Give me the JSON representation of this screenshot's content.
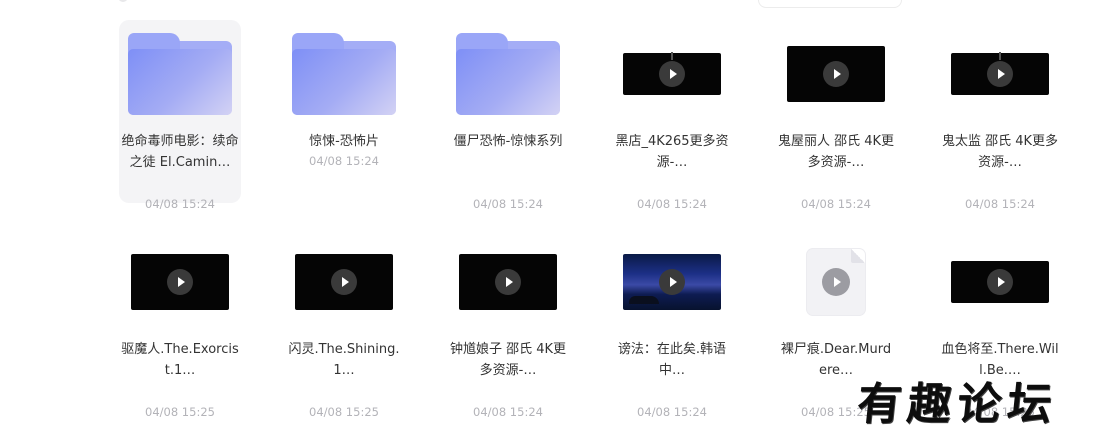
{
  "files": [
    {
      "name": "绝命毒师电影：续命之徒 El.Camin…",
      "date": "04/08 15:24",
      "kind": "folder",
      "selected": true
    },
    {
      "name": "惊悚-恐怖片",
      "date": "04/08 15:24",
      "kind": "folder"
    },
    {
      "name": "僵尸恐怖-惊悚系列",
      "date": "04/08 15:24",
      "kind": "folder"
    },
    {
      "name": "黑店_4K265更多资源-…",
      "date": "04/08 15:24",
      "kind": "video"
    },
    {
      "name": "鬼屋丽人 邵氏 4K更多资源-…",
      "date": "04/08 15:24",
      "kind": "video"
    },
    {
      "name": "鬼太监 邵氏 4K更多资源-…",
      "date": "04/08 15:24",
      "kind": "video"
    },
    {
      "name": "驱魔人.The.Exorcist.1…",
      "date": "04/08 15:25",
      "kind": "video"
    },
    {
      "name": "闪灵.The.Shining.1…",
      "date": "04/08 15:25",
      "kind": "video"
    },
    {
      "name": "钟馗娘子 邵氏 4K更多资源-…",
      "date": "04/08 15:24",
      "kind": "video"
    },
    {
      "name": "谤法：在此矣.韩语中…",
      "date": "04/08 15:24",
      "kind": "video-thumbnail"
    },
    {
      "name": "裸尸痕.Dear.Murdere…",
      "date": "04/08 15:25",
      "kind": "video-file"
    },
    {
      "name": "血色将至.There.Will.Be.…",
      "date": "04/08 15:25",
      "kind": "video"
    }
  ],
  "watermark": "有趣论坛",
  "icons": {
    "folder": "folder-icon",
    "play": "play-icon"
  },
  "colors": {
    "folder": "#8f9bf6",
    "selection": "#f4f4f6",
    "date": "#b3b3b8"
  }
}
